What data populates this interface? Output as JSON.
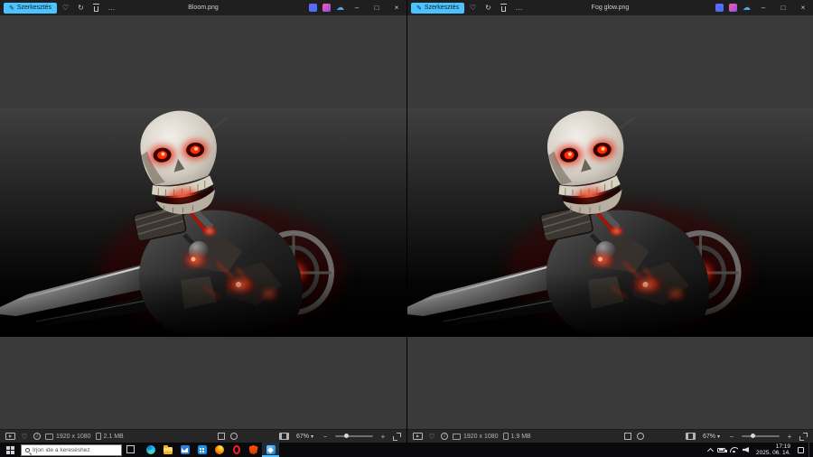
{
  "windows": [
    {
      "title": "Bloom.png",
      "edit_label": "Szerkesztés",
      "resolution": "1920 x 1080",
      "file_size": "2.1 MB",
      "zoom": "67%"
    },
    {
      "title": "Fog glow.png",
      "edit_label": "Szerkesztés",
      "resolution": "1920 x 1080",
      "file_size": "1.9 MB",
      "zoom": "67%"
    }
  ],
  "taskbar": {
    "search_placeholder": "Írjon ide a kereséshez",
    "apps": [
      "edge",
      "file-explorer",
      "mail",
      "store",
      "firefox",
      "opera",
      "brave",
      "photos"
    ],
    "active_app": "photos",
    "time": "17:19",
    "date": "2025. 06. 14."
  },
  "icons": {
    "edit_pencil": "✎",
    "heart": "♡",
    "rotate": "↻",
    "more": "…",
    "minimize": "–",
    "maximize": "□",
    "close": "×",
    "cloud": "☁",
    "play": "▶",
    "info": "i",
    "caret": "▾",
    "zoom_out": "−",
    "zoom_in": "+"
  },
  "colors": {
    "accent": "#4cc2ff"
  }
}
